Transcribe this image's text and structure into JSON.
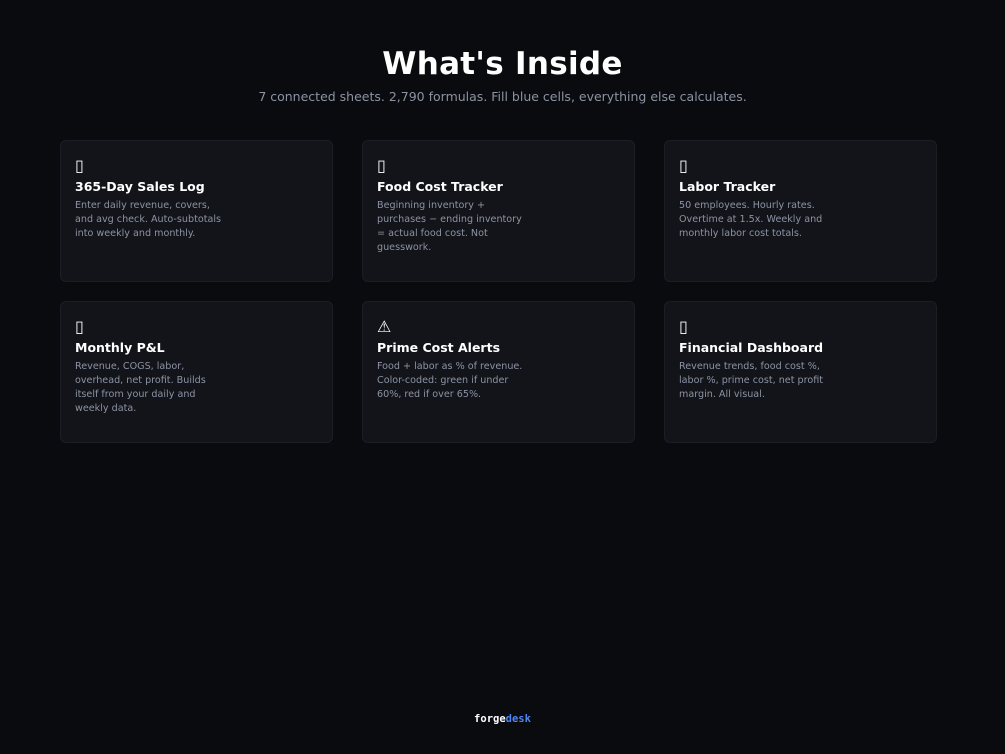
{
  "header": {
    "title": "What's Inside",
    "subtitle": "7 connected sheets. 2,790 formulas. Fill blue cells, everything else calculates."
  },
  "cards": [
    {
      "icon": "▯",
      "icon_name": "sales-log-icon",
      "title": "365-Day Sales Log",
      "description": "Enter daily revenue, covers, and avg check. Auto-subtotals into weekly and monthly."
    },
    {
      "icon": "▯",
      "icon_name": "food-cost-icon",
      "title": "Food Cost Tracker",
      "description": "Beginning inventory + purchases − ending inventory = actual food cost. Not guesswork."
    },
    {
      "icon": "▯",
      "icon_name": "labor-icon",
      "title": "Labor Tracker",
      "description": "50 employees. Hourly rates. Overtime at 1.5x. Weekly and monthly labor cost totals."
    },
    {
      "icon": "▯",
      "icon_name": "pnl-icon",
      "title": "Monthly P&L",
      "description": "Revenue, COGS, labor, overhead, net profit. Builds itself from your daily and weekly data."
    },
    {
      "icon": "⚠",
      "icon_name": "warning-icon",
      "title": "Prime Cost Alerts",
      "description": "Food + labor as % of revenue. Color-coded: green if under 60%, red if over 65%."
    },
    {
      "icon": "▯",
      "icon_name": "dashboard-icon",
      "title": "Financial Dashboard",
      "description": "Revenue trends, food cost %, labor %, prime cost, net profit margin. All visual."
    }
  ],
  "footer": {
    "brand_part1": "forge",
    "brand_part2": "desk"
  },
  "colors": {
    "background": "#090b0f",
    "card": "#12141a",
    "text_muted": "#8b93a3",
    "brand_accent": "#4f86f7"
  }
}
